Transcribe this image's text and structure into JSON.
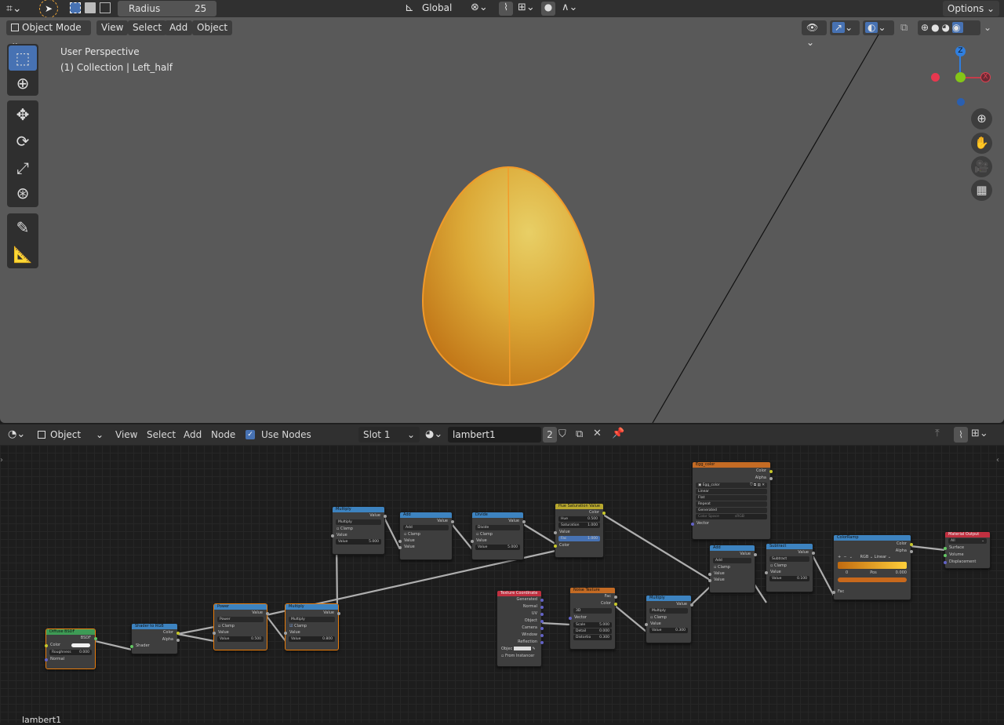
{
  "toolbar": {
    "radius_label": "Radius",
    "radius_value": "25",
    "transform_orientation": "Global",
    "options_label": "Options"
  },
  "viewport_header": {
    "mode": "Object Mode",
    "menus": [
      "View",
      "Select",
      "Add",
      "Object"
    ]
  },
  "viewport": {
    "perspective_label": "User Perspective",
    "collection_label": "(1) Collection | Left_half",
    "gizmo": {
      "z": "Z",
      "x": "X"
    }
  },
  "node_header": {
    "mode": "Object",
    "menus": [
      "View",
      "Select",
      "Add",
      "Node"
    ],
    "use_nodes_label": "Use Nodes",
    "slot": "Slot 1",
    "material_name": "lambert1",
    "user_count": "2"
  },
  "nodes": {
    "diffuse": {
      "title": "Diffuse BSDF",
      "out": "BSDF",
      "color": "Color",
      "roughness": "Roughness",
      "roughness_val": "0.000",
      "normal": "Normal"
    },
    "shader_rgb": {
      "title": "Shader to RGB",
      "color": "Color",
      "alpha": "Alpha",
      "shader": "Shader"
    },
    "power": {
      "title": "Power",
      "out": "Value",
      "op": "Power",
      "clamp": "Clamp",
      "value": "Value",
      "value2": "Value",
      "value2_val": "0.500"
    },
    "multiply1": {
      "title": "Multiply",
      "out": "Value",
      "op": "Multiply",
      "clamp": "Clamp",
      "value": "Value",
      "value2": "Value",
      "value2_val": "0.800"
    },
    "multiply2": {
      "title": "Multiply",
      "out": "Value",
      "op": "Multiply",
      "clamp": "Clamp",
      "value": "Value",
      "value2": "Value",
      "value2_val": "5.000"
    },
    "add1": {
      "title": "Add",
      "out": "Value",
      "op": "Add",
      "clamp": "Clamp",
      "value": "Value",
      "value2": "Value"
    },
    "divide": {
      "title": "Divide",
      "out": "Value",
      "op": "Divide",
      "clamp": "Clamp",
      "value": "Value",
      "value2": "Value",
      "value2_val": "5.000"
    },
    "hsv": {
      "title": "Hue Saturation Value",
      "out": "Color",
      "hue": "Hue",
      "hue_val": "0.500",
      "sat": "Saturation",
      "sat_val": "1.000",
      "value": "Value",
      "fac": "Fac",
      "fac_val": "1.000",
      "color": "Color"
    },
    "texcoord": {
      "title": "Texture Coordinate",
      "outs": [
        "Generated",
        "Normal",
        "UV",
        "Object",
        "Camera",
        "Window",
        "Reflection"
      ],
      "object": "Objec",
      "from_instancer": "From Instancer"
    },
    "noise": {
      "title": "Noise Texture",
      "fac": "Fac",
      "color": "Color",
      "dim": "3D",
      "vector": "Vector",
      "scale": "Scale",
      "scale_val": "5.000",
      "detail": "Detail",
      "detail_val": "0.000",
      "distortion": "Distortio",
      "distortion_val": "0.300"
    },
    "multiply3": {
      "title": "Multiply",
      "out": "Value",
      "op": "Multiply",
      "clamp": "Clamp",
      "value": "Value",
      "value2": "Value",
      "value2_val": "0.300"
    },
    "egg": {
      "title": "Egg_color",
      "color": "Color",
      "alpha": "Alpha",
      "image": "Egg_color",
      "interp": "Linear",
      "proj": "Flat",
      "ext": "Repeat",
      "source": "Generated",
      "colorspace": "Color Space",
      "colorspace_val": "sRGB",
      "vector": "Vector"
    },
    "add2": {
      "title": "Add",
      "out": "Value",
      "op": "Add",
      "clamp": "Clamp",
      "value": "Value",
      "value2": "Value"
    },
    "subtract": {
      "title": "Subtract",
      "out": "Value",
      "op": "Subtract",
      "clamp": "Clamp",
      "value": "Value",
      "value2": "Value",
      "value2_val": "0.100"
    },
    "colorramp": {
      "title": "ColorRamp",
      "color": "Color",
      "alpha": "Alpha",
      "mode": "RGB",
      "interp": "Linear",
      "index": "0",
      "pos": "Pos",
      "pos_val": "0.000",
      "fac": "Fac"
    },
    "output": {
      "title": "Material Output",
      "target": "All",
      "surface": "Surface",
      "volume": "Volume",
      "displacement": "Displacement"
    }
  },
  "footer": {
    "material_label": "lambert1"
  },
  "colors": {
    "accent": "#4772b3",
    "selected": "#e87d0d",
    "egg_light": "#e3bd52",
    "egg_dark": "#c7700f"
  }
}
